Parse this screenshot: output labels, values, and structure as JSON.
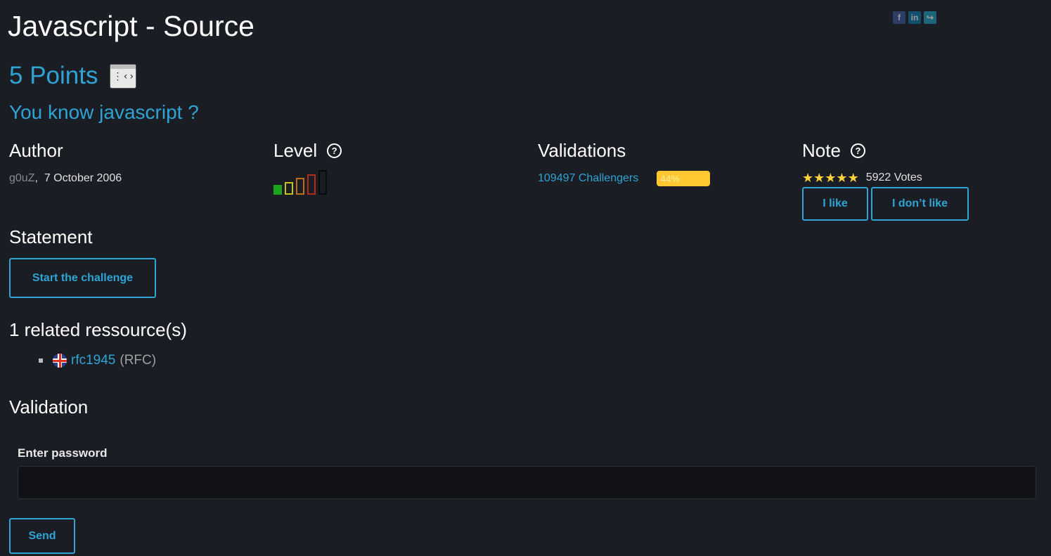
{
  "page": {
    "title": "Javascript - Source",
    "points": "5 Points",
    "category_icon": "source-code-window-icon",
    "subtitle": "You know javascript ?"
  },
  "social": [
    {
      "name": "facebook-icon",
      "glyph": "f",
      "color": "#3b5998"
    },
    {
      "name": "linkedin-icon",
      "glyph": "in",
      "color": "#0e76a8"
    },
    {
      "name": "share-icon",
      "glyph": "↪",
      "color": "#1da1c2"
    }
  ],
  "author": {
    "heading": "Author",
    "name": "g0uZ",
    "separator": ",",
    "date": "7 October 2006"
  },
  "level": {
    "heading": "Level",
    "help": "?",
    "current": 1,
    "max": 5,
    "colors": [
      "#1aa51a",
      "#c9c21a",
      "#c06d1a",
      "#b32c1a",
      "#111111"
    ]
  },
  "validations": {
    "heading": "Validations",
    "challengers": "109497 Challengers",
    "percent": "44%",
    "bar_color": "#ffc830"
  },
  "note": {
    "heading": "Note",
    "help": "?",
    "stars": 5,
    "star_glyph": "★",
    "votes": "5922 Votes",
    "like_label": "I like",
    "dislike_label": "I don’t like"
  },
  "statement": {
    "heading": "Statement",
    "start_label": "Start the challenge"
  },
  "resources": {
    "heading": "1 related ressource(s)",
    "items": [
      {
        "flag": "uk-flag-icon",
        "link": "rfc1945",
        "type": "(RFC)"
      }
    ]
  },
  "validation": {
    "heading": "Validation",
    "password_label": "Enter password",
    "password_value": "",
    "placeholder": "",
    "send_label": "Send"
  }
}
